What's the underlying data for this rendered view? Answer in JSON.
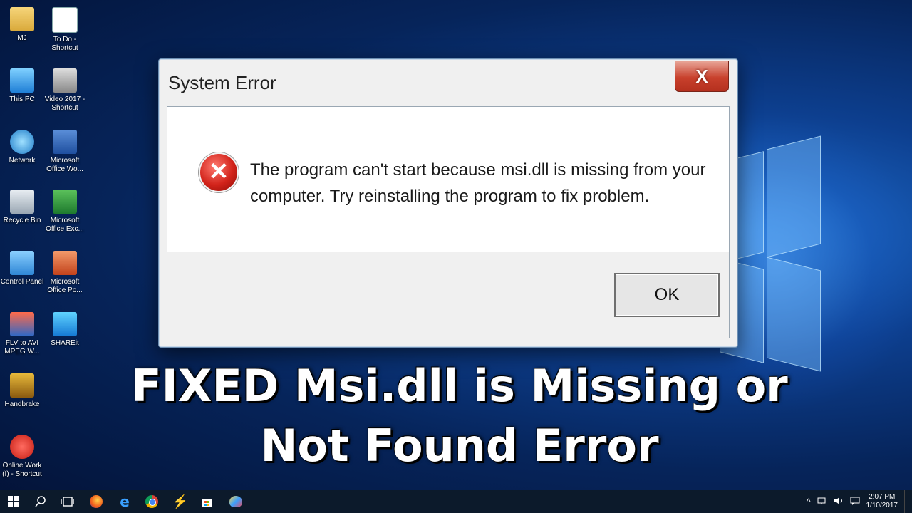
{
  "desktop": {
    "icons": [
      {
        "label": "MJ"
      },
      {
        "label": "To Do - Shortcut"
      },
      {
        "label": "This PC"
      },
      {
        "label": "Video 2017 - Shortcut"
      },
      {
        "label": "Network"
      },
      {
        "label": "Microsoft Office Wo..."
      },
      {
        "label": "Recycle Bin"
      },
      {
        "label": "Microsoft Office Exc..."
      },
      {
        "label": "Control Panel"
      },
      {
        "label": "Microsoft Office Po..."
      },
      {
        "label": "FLV to AVI MPEG W..."
      },
      {
        "label": "SHAREit"
      },
      {
        "label": "Handbrake"
      },
      {
        "label": "Online Work (I) - Shortcut"
      }
    ]
  },
  "dialog": {
    "title": "System Error",
    "close_symbol": "X",
    "error_symbol": "✕",
    "message": "The program can't start because msi.dll is missing from your computer. Try reinstalling the program to fix problem.",
    "ok_label": "OK"
  },
  "headline": {
    "line1": "FIXED Msi.dll is Missing or",
    "line2": "Not Found Error"
  },
  "taskbar": {
    "time": "2:07 PM",
    "date": "1/10/2017",
    "icons": [
      "windows-start-icon",
      "search-icon",
      "task-view-icon",
      "firefox-icon",
      "edge-icon",
      "chrome-icon",
      "winamp-icon",
      "store-icon",
      "paint-icon"
    ]
  },
  "colors": {
    "desktop_bg": "#0d3f8f",
    "close_button": "#c8402c",
    "error_icon": "#d2231a",
    "taskbar": "#0c1a2b"
  }
}
